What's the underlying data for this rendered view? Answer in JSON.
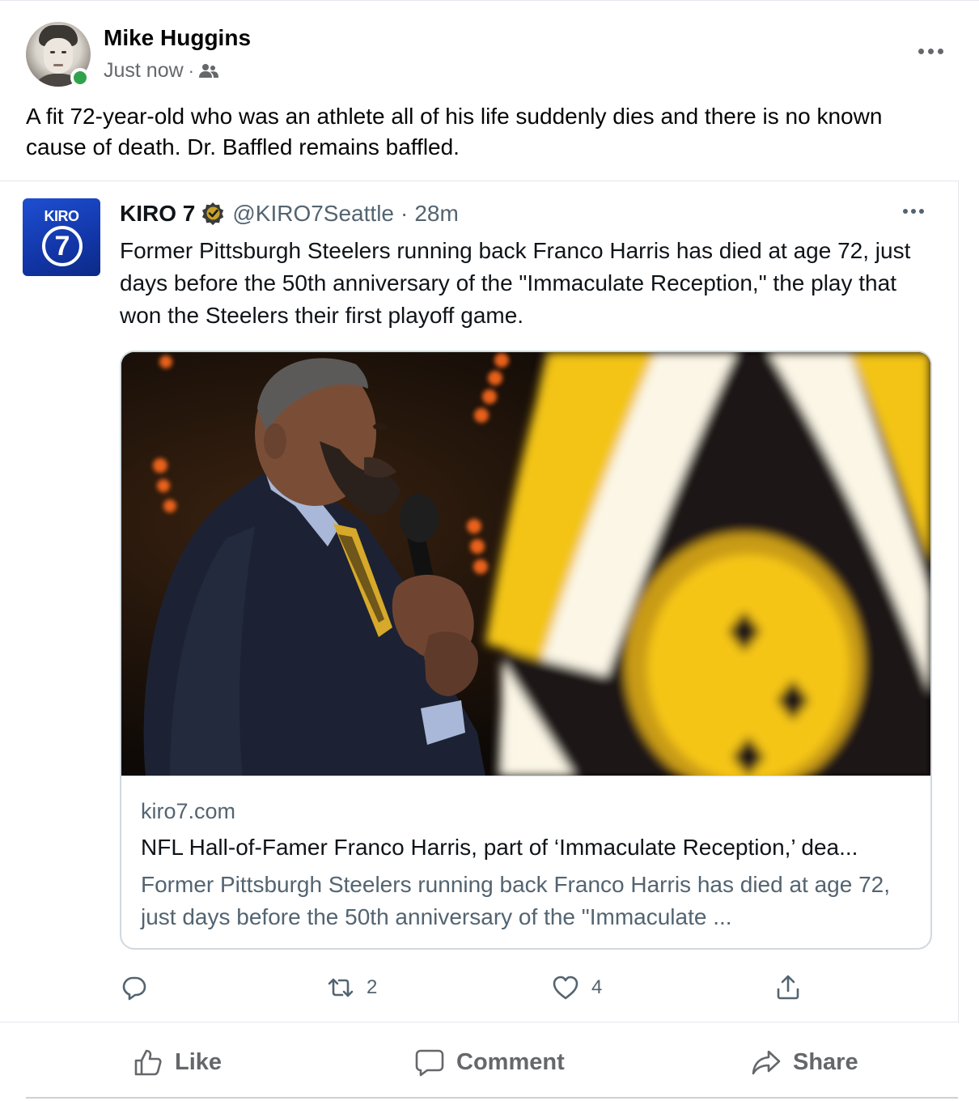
{
  "post": {
    "author": "Mike Huggins",
    "timestamp": "Just now",
    "separator": "·",
    "audience_icon": "friends-icon",
    "text": "A fit 72-year-old who was an athlete all of his life suddenly dies and there is no known cause of death. Dr. Baffled remains baffled."
  },
  "tweet": {
    "logo_text": "KIRO",
    "logo_number": "7",
    "name": "KIRO 7",
    "handle": "@KIRO7Seattle",
    "separator": "·",
    "time": "28m",
    "text": "Former Pittsburgh Steelers running back Franco Harris has died at age 72, just days before the 50th anniversary of the \"Immaculate Reception,\" the play that won the Steelers their first playoff game.",
    "card": {
      "domain": "kiro7.com",
      "title": "NFL Hall-of-Famer Franco Harris, part of ‘Immaculate Reception,’ dea...",
      "description": "Former Pittsburgh Steelers running back Franco Harris has died at age 72, just days before the 50th anniversary of the \"Immaculate ..."
    },
    "actions": {
      "reply_count": "",
      "retweet_count": "2",
      "like_count": "4"
    }
  },
  "actions": {
    "like": "Like",
    "comment": "Comment",
    "share": "Share"
  },
  "colors": {
    "online": "#31a24c",
    "secondary_text": "#65676b",
    "twitter_gray": "#536471",
    "kiro_blue": "#1e4fd1",
    "steelers_gold": "#f5c518"
  }
}
